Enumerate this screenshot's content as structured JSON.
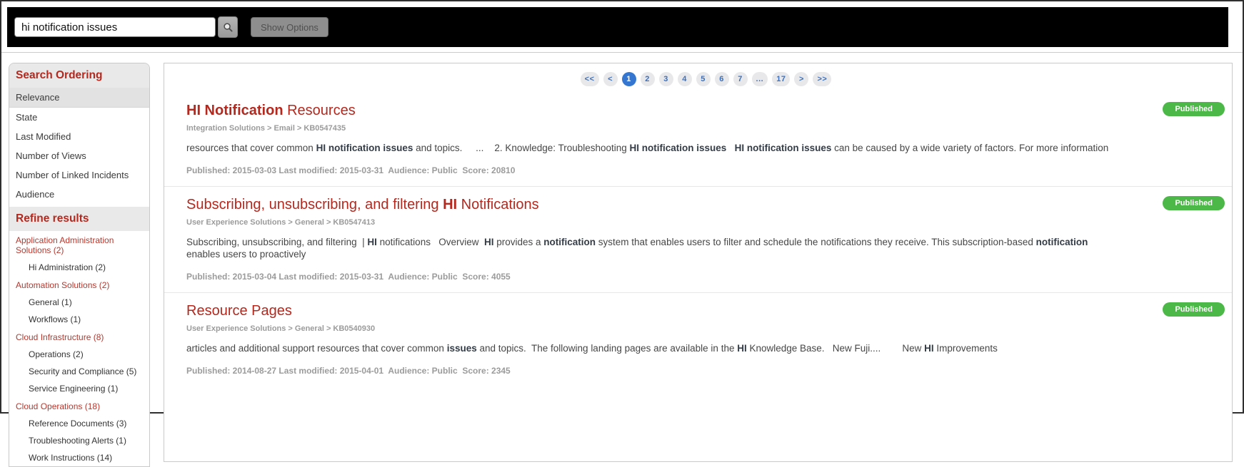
{
  "colors": {
    "accent_red": "#b5281e",
    "refine_red": "#b5382e",
    "link_blue": "#3a70c0",
    "active_page_blue": "#3577d0",
    "badge_green": "#4cb848",
    "topbar_black": "#000000"
  },
  "topbar": {
    "search_value": "hi notification issues",
    "search_icon": "magnifier-icon",
    "show_options_label": "Show Options"
  },
  "sidebar": {
    "ordering": {
      "title": "Search Ordering",
      "items": [
        {
          "label": "Relevance",
          "selected": true
        },
        {
          "label": "State",
          "selected": false
        },
        {
          "label": "Last Modified",
          "selected": false
        },
        {
          "label": "Number of Views",
          "selected": false
        },
        {
          "label": "Number of Linked Incidents",
          "selected": false
        },
        {
          "label": "Audience",
          "selected": false
        }
      ]
    },
    "refine": {
      "title": "Refine results",
      "groups": [
        {
          "label": "Application Administration Solutions (2)",
          "children": [
            "Hi Administration (2)"
          ]
        },
        {
          "label": "Automation Solutions (2)",
          "children": [
            "General (1)",
            "Workflows (1)"
          ]
        },
        {
          "label": "Cloud Infrastructure (8)",
          "children": [
            "Operations (2)",
            "Security and Compliance (5)",
            "Service Engineering (1)"
          ]
        },
        {
          "label": "Cloud Operations (18)",
          "children": [
            "Reference Documents (3)",
            "Troubleshooting Alerts (1)",
            "Work Instructions (14)"
          ]
        }
      ]
    }
  },
  "pagination": {
    "items": [
      {
        "label": "<<",
        "type": "first"
      },
      {
        "label": "<",
        "type": "prev"
      },
      {
        "label": "1",
        "type": "page",
        "active": true
      },
      {
        "label": "2",
        "type": "page"
      },
      {
        "label": "3",
        "type": "page"
      },
      {
        "label": "4",
        "type": "page"
      },
      {
        "label": "5",
        "type": "page"
      },
      {
        "label": "6",
        "type": "page"
      },
      {
        "label": "7",
        "type": "page"
      },
      {
        "label": "...",
        "type": "ellipsis"
      },
      {
        "label": "17",
        "type": "page"
      },
      {
        "label": ">",
        "type": "next"
      },
      {
        "label": ">>",
        "type": "last"
      }
    ]
  },
  "results": [
    {
      "title": [
        {
          "t": "HI Notification",
          "b": true
        },
        {
          "t": " Resources",
          "b": false
        }
      ],
      "breadcrumb": "Integration Solutions > Email > KB0547435",
      "snippet": [
        {
          "t": "resources that cover common ",
          "b": false
        },
        {
          "t": "HI notification issues",
          "b": true
        },
        {
          "t": " and topics.     ...    2. Knowledge: Troubleshooting ",
          "b": false
        },
        {
          "t": "HI notification issues",
          "b": true
        },
        {
          "t": "   ",
          "b": false
        },
        {
          "t": "HI notification issues",
          "b": true
        },
        {
          "t": " can be caused by a wide variety of factors. For more information",
          "b": false
        }
      ],
      "meta": "Published: 2015-03-03 Last modified: 2015-03-31  Audience: Public  Score: 20810",
      "badge": "Published"
    },
    {
      "title": [
        {
          "t": "Subscribing, unsubscribing, and filtering ",
          "b": false
        },
        {
          "t": "HI",
          "b": true
        },
        {
          "t": " Notifications",
          "b": false
        }
      ],
      "breadcrumb": "User Experience Solutions > General > KB0547413",
      "snippet": [
        {
          "t": "Subscribing, unsubscribing, and filtering  | ",
          "b": false
        },
        {
          "t": "HI",
          "b": true
        },
        {
          "t": " notifications   Overview  ",
          "b": false
        },
        {
          "t": "HI",
          "b": true
        },
        {
          "t": " provides a ",
          "b": false
        },
        {
          "t": "notification",
          "b": true
        },
        {
          "t": " system that enables users to filter and schedule the notifications they receive. This subscription-based ",
          "b": false
        },
        {
          "t": "notification",
          "b": true
        },
        {
          "t": " enables users to proactively",
          "b": false
        }
      ],
      "meta": "Published: 2015-03-04 Last modified: 2015-03-31  Audience: Public  Score: 4055",
      "badge": "Published"
    },
    {
      "title": [
        {
          "t": "Resource Pages",
          "b": false
        }
      ],
      "breadcrumb": "User Experience Solutions > General > KB0540930",
      "snippet": [
        {
          "t": "articles and additional support resources that cover common ",
          "b": false
        },
        {
          "t": "issues",
          "b": true
        },
        {
          "t": " and topics.  The following landing pages are available in the ",
          "b": false
        },
        {
          "t": "HI",
          "b": true
        },
        {
          "t": " Knowledge Base.   New Fuji....        New ",
          "b": false
        },
        {
          "t": "HI",
          "b": true
        },
        {
          "t": " Improvements",
          "b": false
        }
      ],
      "meta": "Published: 2014-08-27 Last modified: 2015-04-01  Audience: Public  Score: 2345",
      "badge": "Published"
    }
  ]
}
